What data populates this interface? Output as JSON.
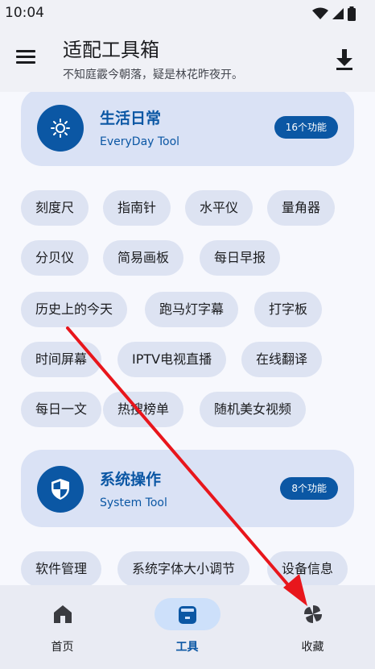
{
  "status_bar": {
    "time": "10:04"
  },
  "app_bar": {
    "title": "适配工具箱",
    "subtitle": "不知庭霰今朝落，疑是林花昨夜开。"
  },
  "sections": [
    {
      "title": "生活日常",
      "subtitle": "EveryDay Tool",
      "badge": "16个功能",
      "icon": "sun-settings-icon",
      "tools": [
        [
          "刻度尺",
          "指南针",
          "水平仪",
          "量角器"
        ],
        [
          "分贝仪",
          "简易画板",
          "每日早报"
        ],
        [
          "历史上的今天",
          "跑马灯字幕",
          "打字板"
        ],
        [
          "时间屏幕",
          "IPTV电视直播",
          "在线翻译"
        ],
        [
          "每日一文",
          "热搜榜单",
          "随机美女视频"
        ]
      ]
    },
    {
      "title": "系统操作",
      "subtitle": "System Tool",
      "badge": "8个功能",
      "icon": "shield-icon",
      "tools": [
        [
          "软件管理",
          "系统字体大小调节",
          "设备信息"
        ]
      ]
    }
  ],
  "bottom_nav": [
    {
      "label": "首页",
      "icon": "home-icon",
      "active": false
    },
    {
      "label": "工具",
      "icon": "toolbox-icon",
      "active": true
    },
    {
      "label": "收藏",
      "icon": "pinwheel-icon",
      "active": false
    }
  ],
  "colors": {
    "primary": "#0b57a4",
    "card": "#dae2f5",
    "chip": "#dde3f2",
    "annotation_arrow": "#e8161c"
  }
}
